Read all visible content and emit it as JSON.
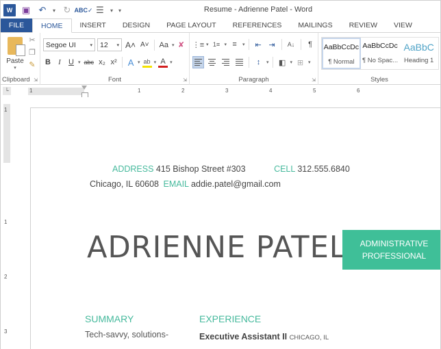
{
  "window": {
    "title": "Resume - Adrienne Patel - Word"
  },
  "quick_access": {
    "icons": [
      "word-logo-icon",
      "save-icon",
      "undo-icon",
      "redo-icon",
      "spelling-icon",
      "bullets-icon",
      "customize-icon"
    ],
    "word_logo_text": "W",
    "save_glyph": "💾",
    "undo_glyph": "↶",
    "redo_glyph": "↻",
    "spelling_glyph": "ABC✓",
    "bullets_glyph": "☰",
    "customize_glyph": "▾"
  },
  "tabs": [
    {
      "label": "FILE"
    },
    {
      "label": "HOME",
      "active": true
    },
    {
      "label": "INSERT"
    },
    {
      "label": "DESIGN"
    },
    {
      "label": "PAGE LAYOUT"
    },
    {
      "label": "REFERENCES"
    },
    {
      "label": "MAILINGS"
    },
    {
      "label": "REVIEW"
    },
    {
      "label": "VIEW"
    }
  ],
  "ribbon": {
    "clipboard": {
      "label": "Clipboard",
      "paste_label": "Paste",
      "cut_glyph": "✂",
      "copy_glyph": "❐",
      "format_painter_glyph": "🖌"
    },
    "font": {
      "label": "Font",
      "font_name": "Segoe UI",
      "font_size": "12",
      "grow_glyph": "A˄",
      "shrink_glyph": "A˅",
      "case_glyph": "Aa",
      "clear_glyph": "✘",
      "bold": "B",
      "italic": "I",
      "underline": "U",
      "strikethrough": "abc",
      "subscript": "x₂",
      "superscript": "x²",
      "text_effects": "A",
      "highlight": "ab",
      "font_color": "A",
      "highlight_color": "#f4e300",
      "font_color_bar": "#d21f1f"
    },
    "paragraph": {
      "label": "Paragraph",
      "bullets_glyph": "•≡",
      "numbering_glyph": "1≡",
      "multilevel_glyph": "≡",
      "decrease_indent_glyph": "⇤",
      "increase_indent_glyph": "⇥",
      "sort_glyph": "A↓",
      "pilcrow_glyph": "¶",
      "line_spacing_glyph": "↕",
      "shading_glyph": "◧",
      "borders_glyph": "⊞"
    },
    "styles": {
      "label": "Styles",
      "items": [
        {
          "preview": "AaBbCcDc",
          "name": "¶ Normal",
          "selected": true
        },
        {
          "preview": "AaBbCcDc",
          "name": "¶ No Spac..."
        },
        {
          "preview": "AaBbC",
          "name": "Heading 1"
        }
      ]
    }
  },
  "ruler": {
    "tab_selector_glyph": "└",
    "h_ticks": [
      "1",
      "1",
      "2",
      "3",
      "4",
      "5",
      "6"
    ],
    "v_ticks": [
      "1",
      "1",
      "2",
      "3"
    ]
  },
  "document": {
    "address_label": "ADDRESS",
    "address_value": "415 Bishop Street #303",
    "cell_label": "CELL",
    "cell_value": "312.555.6840",
    "city_value": "Chicago, IL 60608",
    "email_label": "EMAIL",
    "email_value": "addie.patel@gmail.com",
    "name": "ADRIENNE PATEL",
    "title_line1": "ADMINISTRATIVE",
    "title_line2": "PROFESSIONAL",
    "summary_heading": "SUMMARY",
    "summary_text": "Tech-savvy, solutions-",
    "experience_heading": "EXPERIENCE",
    "job_title": "Executive Assistant II",
    "job_location": "CHICAGO, IL"
  },
  "colors": {
    "accent_teal": "#45b99c",
    "title_box": "#3fbf98",
    "file_tab": "#2b579a"
  }
}
